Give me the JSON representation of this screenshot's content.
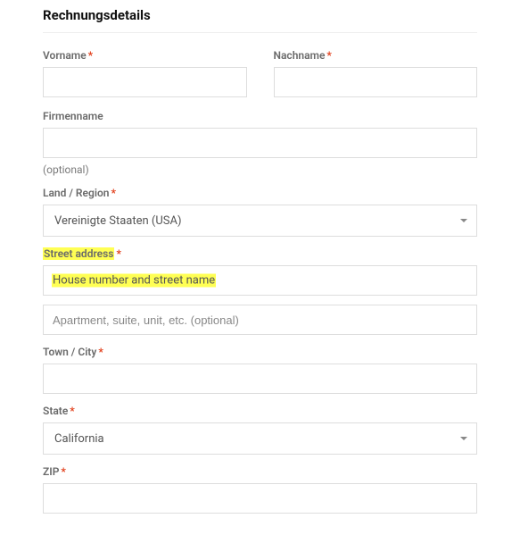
{
  "heading": "Rechnungsdetails",
  "labels": {
    "firstname": "Vorname",
    "lastname": "Nachname",
    "company": "Firmenname",
    "company_optional": "(optional)",
    "country": "Land / Region",
    "street": "Street address",
    "city": "Town / City",
    "state": "State",
    "zip": "ZIP",
    "required_mark": "*"
  },
  "values": {
    "firstname": "",
    "lastname": "",
    "company": "",
    "country": "Vereinigte Staaten (USA)",
    "street1": "",
    "street2": "",
    "city": "",
    "state": "California",
    "zip": ""
  },
  "placeholders": {
    "street1": "House number and street name",
    "street2": "Apartment, suite, unit, etc. (optional)"
  }
}
